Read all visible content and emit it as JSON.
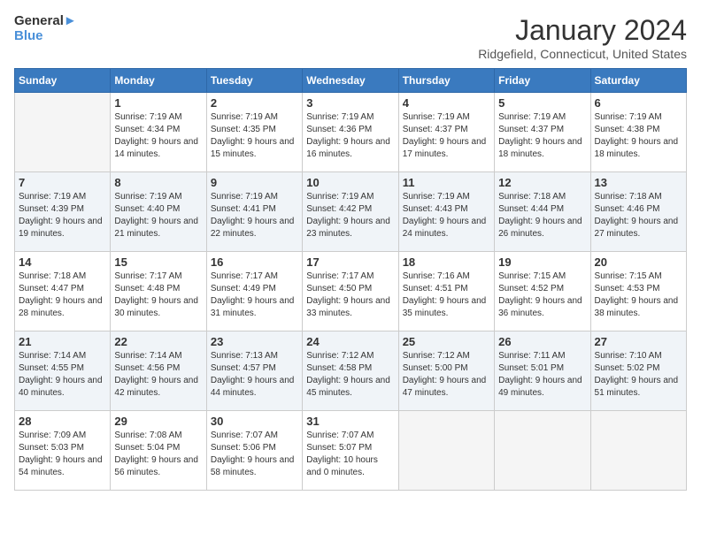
{
  "header": {
    "logo_line1": "General",
    "logo_line2": "Blue",
    "month_title": "January 2024",
    "location": "Ridgefield, Connecticut, United States"
  },
  "weekdays": [
    "Sunday",
    "Monday",
    "Tuesday",
    "Wednesday",
    "Thursday",
    "Friday",
    "Saturday"
  ],
  "weeks": [
    [
      {
        "day": "",
        "sunrise": "",
        "sunset": "",
        "daylight": ""
      },
      {
        "day": "1",
        "sunrise": "Sunrise: 7:19 AM",
        "sunset": "Sunset: 4:34 PM",
        "daylight": "Daylight: 9 hours and 14 minutes."
      },
      {
        "day": "2",
        "sunrise": "Sunrise: 7:19 AM",
        "sunset": "Sunset: 4:35 PM",
        "daylight": "Daylight: 9 hours and 15 minutes."
      },
      {
        "day": "3",
        "sunrise": "Sunrise: 7:19 AM",
        "sunset": "Sunset: 4:36 PM",
        "daylight": "Daylight: 9 hours and 16 minutes."
      },
      {
        "day": "4",
        "sunrise": "Sunrise: 7:19 AM",
        "sunset": "Sunset: 4:37 PM",
        "daylight": "Daylight: 9 hours and 17 minutes."
      },
      {
        "day": "5",
        "sunrise": "Sunrise: 7:19 AM",
        "sunset": "Sunset: 4:37 PM",
        "daylight": "Daylight: 9 hours and 18 minutes."
      },
      {
        "day": "6",
        "sunrise": "Sunrise: 7:19 AM",
        "sunset": "Sunset: 4:38 PM",
        "daylight": "Daylight: 9 hours and 18 minutes."
      }
    ],
    [
      {
        "day": "7",
        "sunrise": "Sunrise: 7:19 AM",
        "sunset": "Sunset: 4:39 PM",
        "daylight": "Daylight: 9 hours and 19 minutes."
      },
      {
        "day": "8",
        "sunrise": "Sunrise: 7:19 AM",
        "sunset": "Sunset: 4:40 PM",
        "daylight": "Daylight: 9 hours and 21 minutes."
      },
      {
        "day": "9",
        "sunrise": "Sunrise: 7:19 AM",
        "sunset": "Sunset: 4:41 PM",
        "daylight": "Daylight: 9 hours and 22 minutes."
      },
      {
        "day": "10",
        "sunrise": "Sunrise: 7:19 AM",
        "sunset": "Sunset: 4:42 PM",
        "daylight": "Daylight: 9 hours and 23 minutes."
      },
      {
        "day": "11",
        "sunrise": "Sunrise: 7:19 AM",
        "sunset": "Sunset: 4:43 PM",
        "daylight": "Daylight: 9 hours and 24 minutes."
      },
      {
        "day": "12",
        "sunrise": "Sunrise: 7:18 AM",
        "sunset": "Sunset: 4:44 PM",
        "daylight": "Daylight: 9 hours and 26 minutes."
      },
      {
        "day": "13",
        "sunrise": "Sunrise: 7:18 AM",
        "sunset": "Sunset: 4:46 PM",
        "daylight": "Daylight: 9 hours and 27 minutes."
      }
    ],
    [
      {
        "day": "14",
        "sunrise": "Sunrise: 7:18 AM",
        "sunset": "Sunset: 4:47 PM",
        "daylight": "Daylight: 9 hours and 28 minutes."
      },
      {
        "day": "15",
        "sunrise": "Sunrise: 7:17 AM",
        "sunset": "Sunset: 4:48 PM",
        "daylight": "Daylight: 9 hours and 30 minutes."
      },
      {
        "day": "16",
        "sunrise": "Sunrise: 7:17 AM",
        "sunset": "Sunset: 4:49 PM",
        "daylight": "Daylight: 9 hours and 31 minutes."
      },
      {
        "day": "17",
        "sunrise": "Sunrise: 7:17 AM",
        "sunset": "Sunset: 4:50 PM",
        "daylight": "Daylight: 9 hours and 33 minutes."
      },
      {
        "day": "18",
        "sunrise": "Sunrise: 7:16 AM",
        "sunset": "Sunset: 4:51 PM",
        "daylight": "Daylight: 9 hours and 35 minutes."
      },
      {
        "day": "19",
        "sunrise": "Sunrise: 7:15 AM",
        "sunset": "Sunset: 4:52 PM",
        "daylight": "Daylight: 9 hours and 36 minutes."
      },
      {
        "day": "20",
        "sunrise": "Sunrise: 7:15 AM",
        "sunset": "Sunset: 4:53 PM",
        "daylight": "Daylight: 9 hours and 38 minutes."
      }
    ],
    [
      {
        "day": "21",
        "sunrise": "Sunrise: 7:14 AM",
        "sunset": "Sunset: 4:55 PM",
        "daylight": "Daylight: 9 hours and 40 minutes."
      },
      {
        "day": "22",
        "sunrise": "Sunrise: 7:14 AM",
        "sunset": "Sunset: 4:56 PM",
        "daylight": "Daylight: 9 hours and 42 minutes."
      },
      {
        "day": "23",
        "sunrise": "Sunrise: 7:13 AM",
        "sunset": "Sunset: 4:57 PM",
        "daylight": "Daylight: 9 hours and 44 minutes."
      },
      {
        "day": "24",
        "sunrise": "Sunrise: 7:12 AM",
        "sunset": "Sunset: 4:58 PM",
        "daylight": "Daylight: 9 hours and 45 minutes."
      },
      {
        "day": "25",
        "sunrise": "Sunrise: 7:12 AM",
        "sunset": "Sunset: 5:00 PM",
        "daylight": "Daylight: 9 hours and 47 minutes."
      },
      {
        "day": "26",
        "sunrise": "Sunrise: 7:11 AM",
        "sunset": "Sunset: 5:01 PM",
        "daylight": "Daylight: 9 hours and 49 minutes."
      },
      {
        "day": "27",
        "sunrise": "Sunrise: 7:10 AM",
        "sunset": "Sunset: 5:02 PM",
        "daylight": "Daylight: 9 hours and 51 minutes."
      }
    ],
    [
      {
        "day": "28",
        "sunrise": "Sunrise: 7:09 AM",
        "sunset": "Sunset: 5:03 PM",
        "daylight": "Daylight: 9 hours and 54 minutes."
      },
      {
        "day": "29",
        "sunrise": "Sunrise: 7:08 AM",
        "sunset": "Sunset: 5:04 PM",
        "daylight": "Daylight: 9 hours and 56 minutes."
      },
      {
        "day": "30",
        "sunrise": "Sunrise: 7:07 AM",
        "sunset": "Sunset: 5:06 PM",
        "daylight": "Daylight: 9 hours and 58 minutes."
      },
      {
        "day": "31",
        "sunrise": "Sunrise: 7:07 AM",
        "sunset": "Sunset: 5:07 PM",
        "daylight": "Daylight: 10 hours and 0 minutes."
      },
      {
        "day": "",
        "sunrise": "",
        "sunset": "",
        "daylight": ""
      },
      {
        "day": "",
        "sunrise": "",
        "sunset": "",
        "daylight": ""
      },
      {
        "day": "",
        "sunrise": "",
        "sunset": "",
        "daylight": ""
      }
    ]
  ]
}
